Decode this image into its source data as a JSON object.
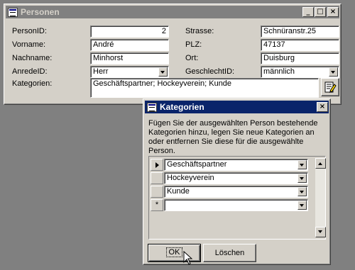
{
  "main_window": {
    "title": "Personen",
    "title_color": "#808080",
    "controls": [
      "_",
      "□",
      "×"
    ],
    "fields": {
      "personid": {
        "label": "PersonID:",
        "value": "2"
      },
      "vorname": {
        "label": "Vorname:",
        "value": "André"
      },
      "nachname": {
        "label": "Nachname:",
        "value": "Minhorst"
      },
      "anredeid": {
        "label": "AnredeID:",
        "value": "Herr"
      },
      "strasse": {
        "label": "Strasse:",
        "value": "Schnüranstr.25"
      },
      "plz": {
        "label": "PLZ:",
        "value": "47137"
      },
      "ort": {
        "label": "Ort:",
        "value": "Duisburg"
      },
      "geschlechtid": {
        "label": "GeschlechtID:",
        "value": "männlich"
      },
      "kategorien": {
        "label": "Kategorien:",
        "value": "Geschäftspartner; Hockeyverein; Kunde"
      }
    }
  },
  "dialog": {
    "title": "Kategorien",
    "title_color": "#0a246a",
    "close_label": "×",
    "description": "Fügen Sie der ausgewählten Person bestehende Kategorien hinzu, legen Sie neue Kategorien an oder entfernen Sie diese für die ausgewählte Person.",
    "rows": [
      {
        "selector": "",
        "value": "Geschäftspartner"
      },
      {
        "selector": "",
        "value": "Hockeyverein"
      },
      {
        "selector": "",
        "value": "Kunde"
      },
      {
        "selector": "*",
        "value": ""
      }
    ],
    "ok_label": "OK",
    "delete_label": "Löschen"
  }
}
